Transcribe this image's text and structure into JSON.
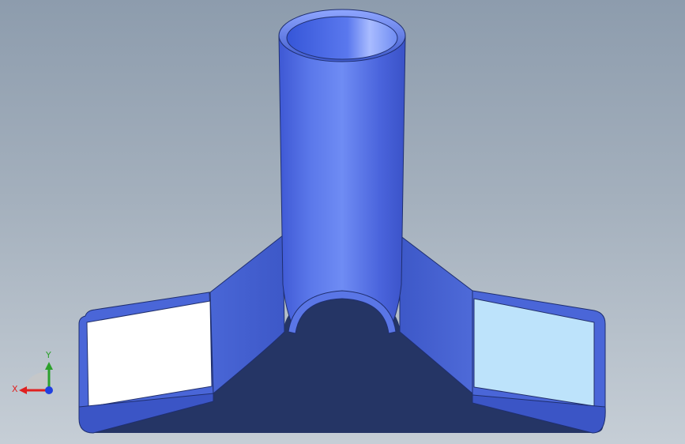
{
  "triad": {
    "x_label": "X",
    "y_label": "Y",
    "x_color": "#e02020",
    "y_color": "#2ca02c",
    "z_color": "#2040e0"
  },
  "colors": {
    "background_top": "#8d9cad",
    "background_bottom": "#c6ced6",
    "tube_body": "#5a76e6",
    "tube_highlight": "#9fb3ff",
    "base_dark": "#253565",
    "wing_left_face": "#ffffff",
    "wing_right_face": "#bde3fb",
    "flank_face": "#4e6ad8"
  }
}
